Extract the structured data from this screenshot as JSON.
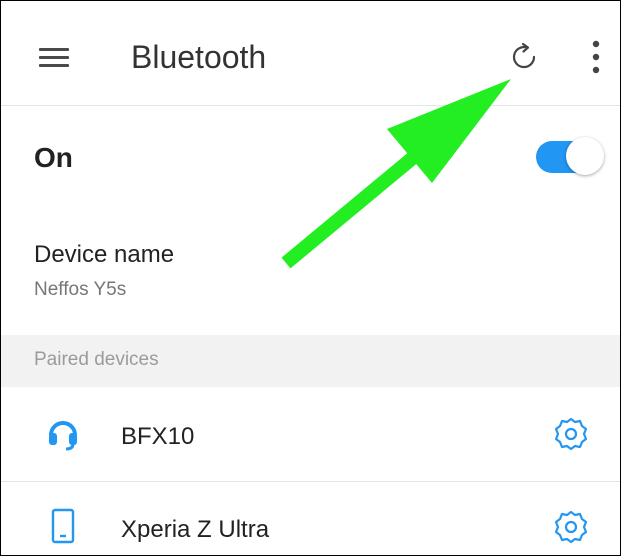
{
  "colors": {
    "accent": "#2196f3",
    "toggle_track": "#2196f3",
    "annotation_arrow": "#22ee22"
  },
  "appbar": {
    "title": "Bluetooth",
    "icons": [
      "menu-icon",
      "refresh-icon",
      "overflow-menu-icon"
    ]
  },
  "bluetooth_toggle": {
    "label": "On",
    "state": true
  },
  "device_name": {
    "label": "Device name",
    "value": "Neffos Y5s"
  },
  "paired_section": {
    "header": "Paired devices",
    "devices": [
      {
        "name": "BFX10",
        "icon": "headset-icon"
      },
      {
        "name": "Xperia Z Ultra",
        "icon": "phone-icon"
      }
    ]
  },
  "annotation": {
    "type": "green-arrow",
    "points_to": "refresh-icon"
  }
}
